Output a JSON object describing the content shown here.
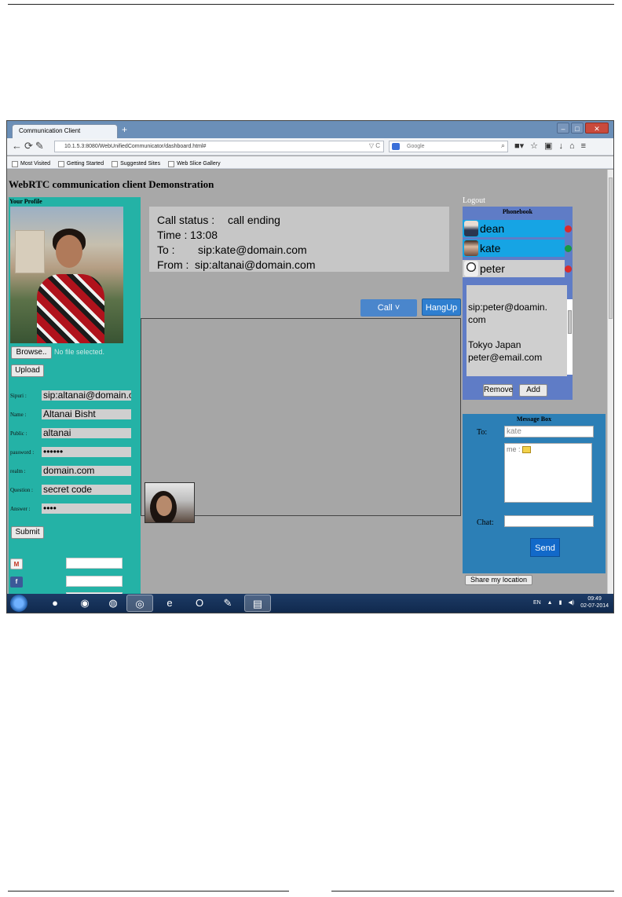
{
  "browser": {
    "tab_title": "Communication Client",
    "new_tab": "+",
    "url": "10.1.5.3:8080/WebUnifiedCommunicator/dashboard.html#",
    "search_placeholder": "Google",
    "bookmarks": [
      "Most Visited",
      "Getting Started",
      "Suggested Sites",
      "Web Slice Gallery"
    ]
  },
  "page": {
    "title": "WebRTC communication client Demonstration"
  },
  "profile": {
    "heading": "Your Profile",
    "browse_label": "Browse..",
    "no_file_text": "No file selected.",
    "upload_label": "Upload",
    "fields": {
      "sipuri": {
        "label": "Sipuri :",
        "value": "sip:altanai@domain.com"
      },
      "name": {
        "label": "Name :",
        "value": "Altanai Bisht"
      },
      "public": {
        "label": "Public :",
        "value": "altanai"
      },
      "password": {
        "label": "password :",
        "value": "••••••"
      },
      "realm": {
        "label": "realm :",
        "value": "domain.com"
      },
      "question": {
        "label": "Question :",
        "value": "secret code"
      },
      "answer": {
        "label": "Answer :",
        "value": "••••"
      }
    },
    "submit_label": "Submit"
  },
  "call_status": {
    "status_label": "Call status :",
    "status_value": "call ending",
    "time_label": "Time :",
    "time_value": "13:08",
    "to_label": "To :",
    "to_value": "sip:kate@domain.com",
    "from_label": "From :",
    "from_value": "sip:altanai@domain.com"
  },
  "controls": {
    "call_label": "Call",
    "hangup_label": "HangUp"
  },
  "phonebook": {
    "logout_label": "Logout",
    "title": "Phonebook",
    "contacts": [
      {
        "name": "dean",
        "status_color": "#d92b2b"
      },
      {
        "name": "kate",
        "status_color": "#169a40"
      },
      {
        "name": "peter",
        "status_color": "#d92b2b"
      }
    ],
    "detail_lines": [
      "sip:peter@doamin.",
      "com",
      "",
      "Tokyo Japan",
      "peter@email.com"
    ],
    "remove_label": "Remove",
    "add_label": "Add"
  },
  "message_box": {
    "title": "Message Box",
    "to_label": "To:",
    "to_value": "kate",
    "log_text": "me :",
    "chat_label": "Chat:",
    "send_label": "Send",
    "share_location_label": "Share my location"
  },
  "taskbar": {
    "language": "EN",
    "time": "09:49",
    "date": "02-07-2014"
  }
}
